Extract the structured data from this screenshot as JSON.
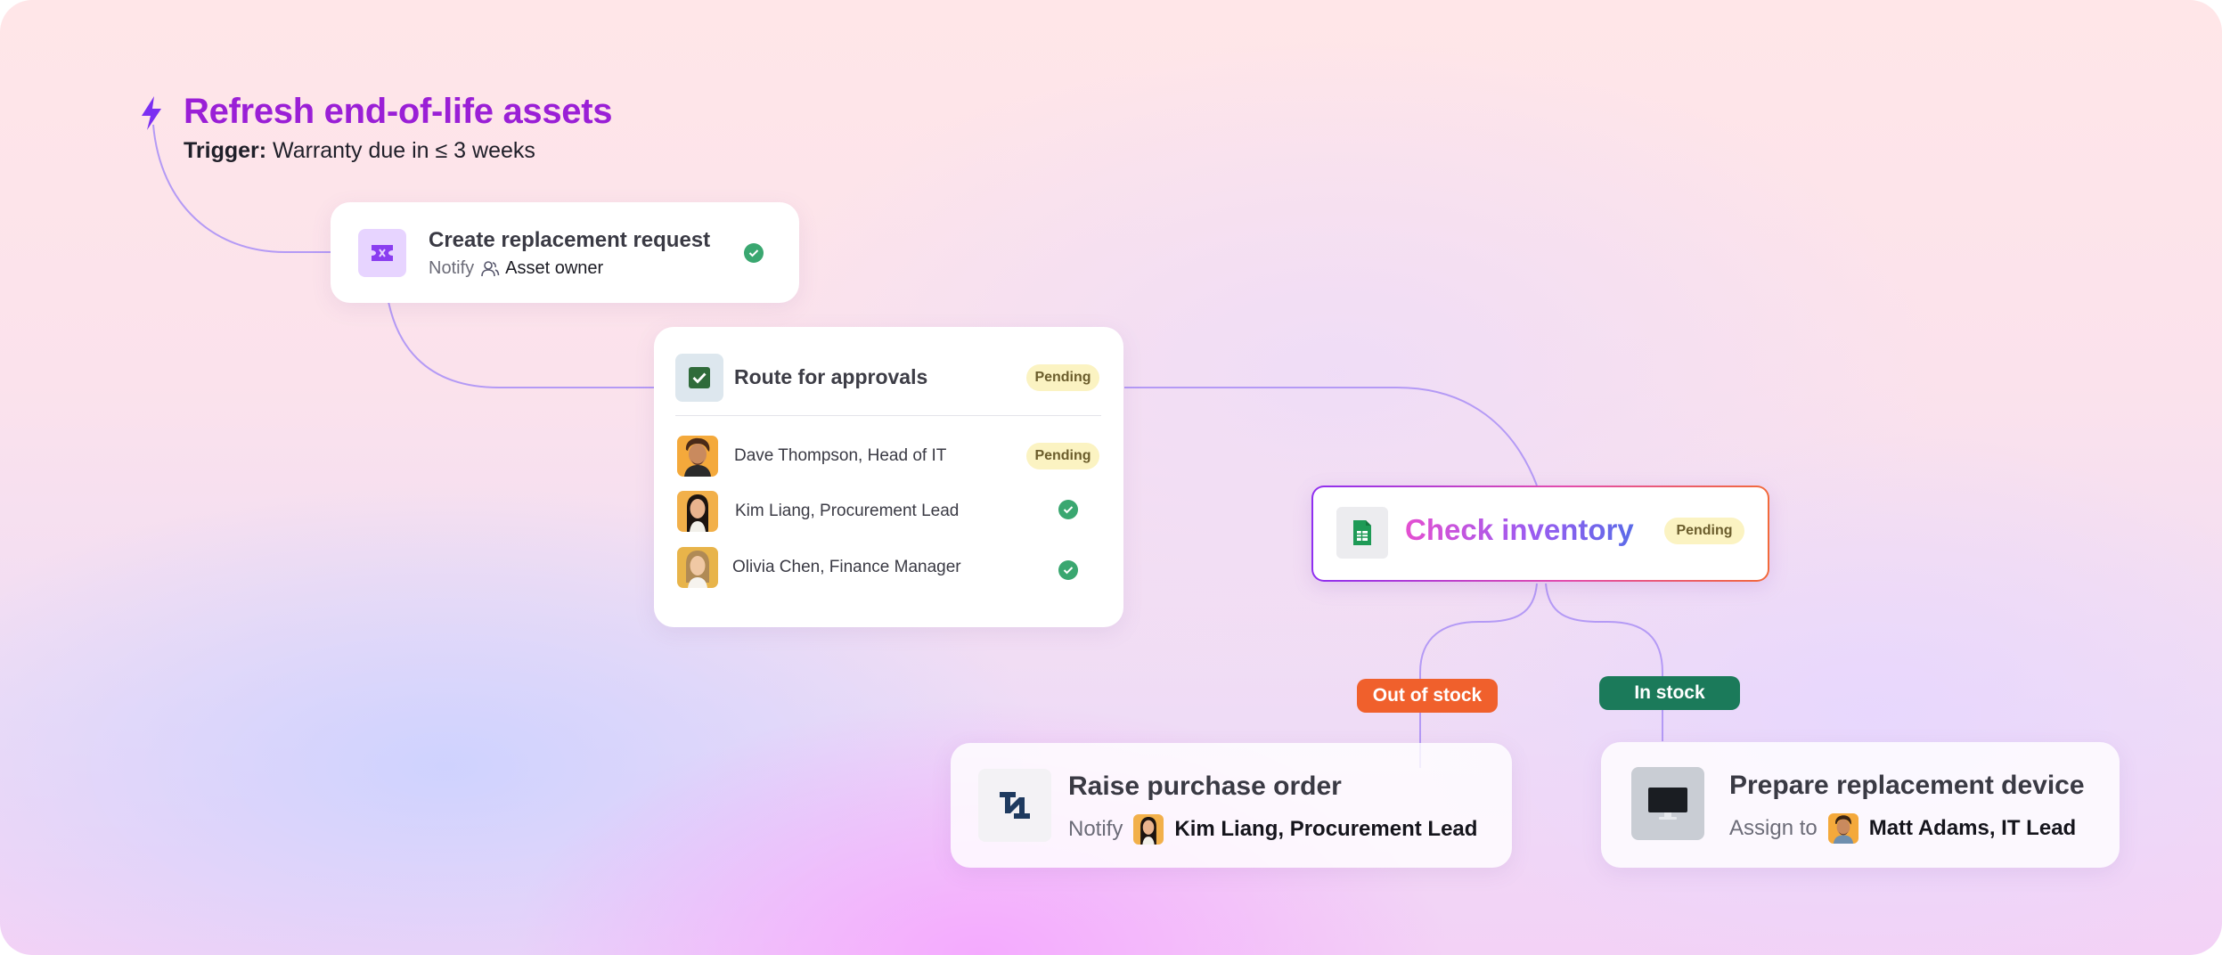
{
  "workflow": {
    "title": "Refresh end-of-life assets",
    "trigger_label": "Trigger:",
    "trigger_value": "Warranty due in ≤ 3 weeks"
  },
  "create_request": {
    "title": "Create replacement request",
    "notify_label": "Notify",
    "recipient": "Asset owner",
    "status": "complete",
    "icon": "ticket-icon"
  },
  "approvals": {
    "title": "Route for approvals",
    "status": "Pending",
    "icon": "checkbox-icon",
    "approvers": [
      {
        "name": "Dave Thompson, Head of IT",
        "status": "Pending"
      },
      {
        "name": "Kim Liang, Procurement Lead",
        "status": "approved"
      },
      {
        "name": "Olivia Chen, Finance Manager",
        "status": "approved"
      }
    ]
  },
  "inventory": {
    "title": "Check inventory",
    "status": "Pending",
    "icon": "spreadsheet-icon"
  },
  "branches": {
    "out_of_stock": {
      "label": "Out of stock",
      "color": "#f0602c"
    },
    "in_stock": {
      "label": "In stock",
      "color": "#1b7a5a"
    }
  },
  "purchase_order": {
    "title": "Raise purchase order",
    "notify_label": "Notify",
    "recipient": "Kim Liang, Procurement Lead",
    "icon": "netsuite-logo-icon"
  },
  "prepare_device": {
    "title": "Prepare replacement device",
    "assign_label": "Assign to",
    "assignee": "Matt Adams, IT Lead",
    "icon": "monitor-icon"
  },
  "colors": {
    "accent_purple": "#9a1fd6",
    "connector": "#b49af5",
    "pending_bg": "#fbf3c2",
    "check_green": "#3aa770"
  }
}
